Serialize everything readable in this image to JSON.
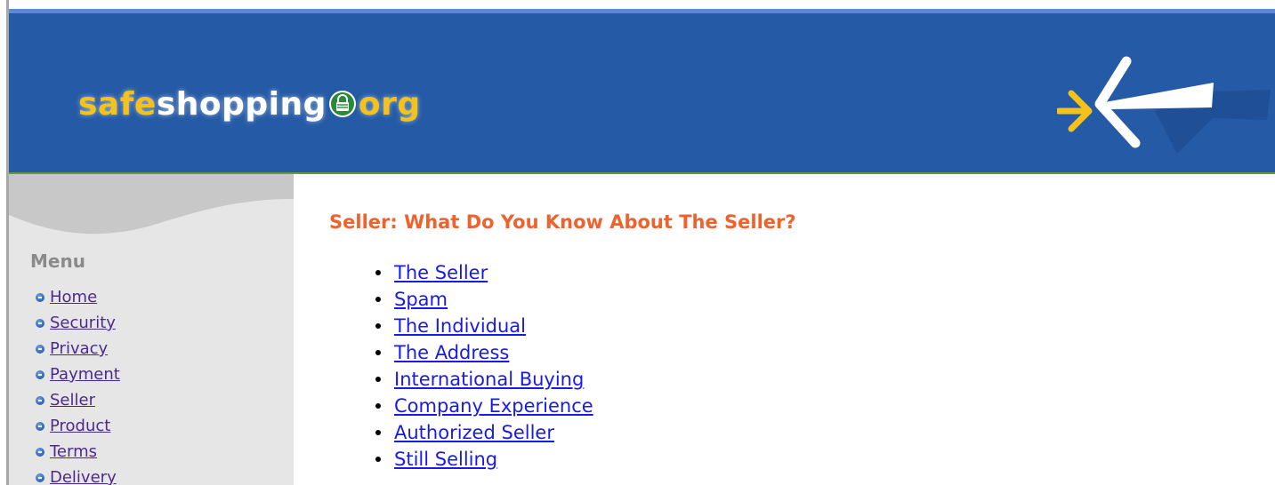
{
  "header": {
    "logo": {
      "part1": "safe",
      "part2": "shopping",
      "part3": "org",
      "lock_icon": "lock-icon",
      "emblem_icon": "arrow-emblem-icon"
    },
    "background_color": "#255aa6"
  },
  "sidebar": {
    "title": "Menu",
    "bullet_icon": "blue-bullet-icon",
    "items": [
      {
        "label": "Home"
      },
      {
        "label": "Security"
      },
      {
        "label": "Privacy"
      },
      {
        "label": "Payment"
      },
      {
        "label": "Seller"
      },
      {
        "label": "Product"
      },
      {
        "label": "Terms"
      },
      {
        "label": "Delivery"
      }
    ]
  },
  "main": {
    "title": "Seller: What Do You Know About The Seller?",
    "title_color": "#f0622c",
    "links": [
      {
        "label": "The Seller"
      },
      {
        "label": "Spam"
      },
      {
        "label": "The Individual"
      },
      {
        "label": "The Address"
      },
      {
        "label": "International Buying"
      },
      {
        "label": "Company Experience"
      },
      {
        "label": "Authorized Seller"
      },
      {
        "label": "Still Selling"
      }
    ],
    "link_color": "#1a1ae6"
  }
}
